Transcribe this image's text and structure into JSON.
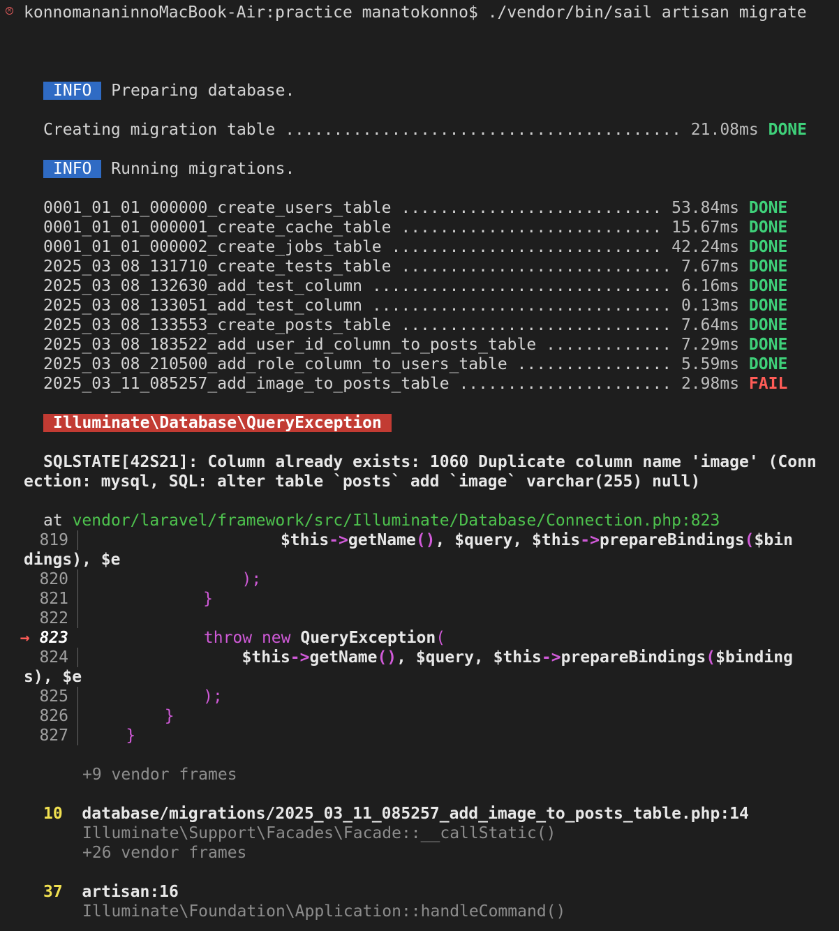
{
  "prompt": {
    "user_host": "konnomananinnoMacBook-Air:practice manatokonno$",
    "command": "./vendor/bin/sail artisan migrate"
  },
  "info1": {
    "badge": "INFO",
    "text": "Preparing database."
  },
  "create_table": {
    "label": "Creating migration table",
    "time": "21.08ms",
    "status": "DONE"
  },
  "info2": {
    "badge": "INFO",
    "text": "Running migrations."
  },
  "migrations": [
    {
      "name": "0001_01_01_000000_create_users_table",
      "time": "53.84ms",
      "status": "DONE"
    },
    {
      "name": "0001_01_01_000001_create_cache_table",
      "time": "15.67ms",
      "status": "DONE"
    },
    {
      "name": "0001_01_01_000002_create_jobs_table",
      "time": "42.24ms",
      "status": "DONE"
    },
    {
      "name": "2025_03_08_131710_create_tests_table",
      "time": "7.67ms",
      "status": "DONE"
    },
    {
      "name": "2025_03_08_132630_add_test_column",
      "time": "6.16ms",
      "status": "DONE"
    },
    {
      "name": "2025_03_08_133051_add_test_column",
      "time": "0.13ms",
      "status": "DONE"
    },
    {
      "name": "2025_03_08_133553_create_posts_table",
      "time": "7.64ms",
      "status": "DONE"
    },
    {
      "name": "2025_03_08_183522_add_user_id_column_to_posts_table",
      "time": "7.29ms",
      "status": "DONE"
    },
    {
      "name": "2025_03_08_210500_add_role_column_to_users_table",
      "time": "5.59ms",
      "status": "DONE"
    },
    {
      "name": "2025_03_11_085257_add_image_to_posts_table",
      "time": "2.98ms",
      "status": "FAIL"
    }
  ],
  "exception": {
    "badge": "Illuminate\\Database\\QueryException",
    "message_line1": "SQLSTATE[42S21]: Column already exists: 1060 Duplicate column name 'image' (Conn",
    "message_line2": "ection: mysql, SQL: alter table `posts` add `image` varchar(255) null)",
    "at_label": "at",
    "file": "vendor/laravel/framework/src/Illuminate/Database/Connection.php",
    "line_ref": ":823"
  },
  "code": {
    "l819_no": "819",
    "l820_no": "820",
    "l821_no": "821",
    "l822_no": "822",
    "l823_no": "823",
    "l824_no": "824",
    "l825_no": "825",
    "l826_no": "826",
    "l827_no": "827",
    "arrow": "→",
    "wrap819": "dings), $e",
    "wrap824": "s), $e"
  },
  "frames": {
    "vendor9": "+9 vendor frames",
    "f10_num": "10",
    "f10_file": "database/migrations/2025_03_11_085257_add_image_to_posts_table.php:14",
    "f10_call": "Illuminate\\Support\\Facades\\Facade::__callStatic()",
    "vendor26": "+26 vendor frames",
    "f37_num": "37",
    "f37_file": "artisan:16",
    "f37_call": "Illuminate\\Foundation\\Application::handleCommand()"
  }
}
